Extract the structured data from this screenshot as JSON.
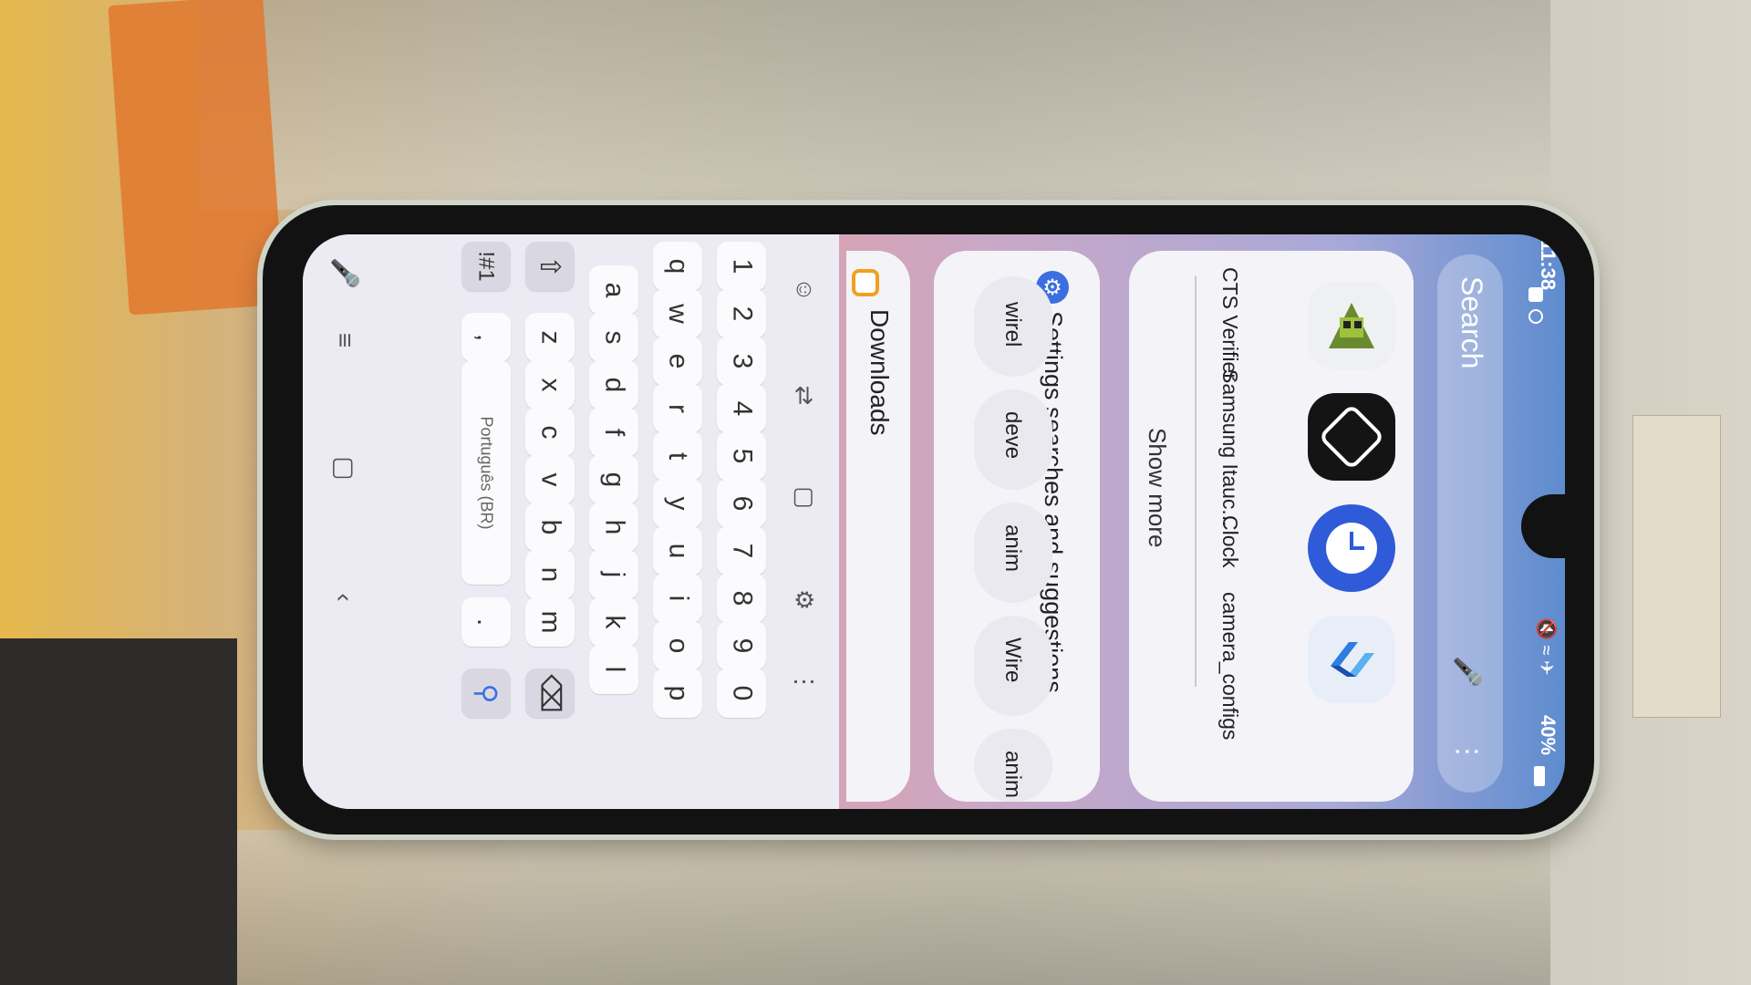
{
  "status_bar": {
    "time": "11:38",
    "battery": "40%",
    "icons": [
      "notification-icon",
      "sync-icon",
      "mute-icon",
      "wifi-icon",
      "airplane-icon",
      "battery-icon"
    ]
  },
  "search": {
    "placeholder": "Search",
    "mic_icon": "mic-icon",
    "more_icon": "more-vert-icon"
  },
  "apps": [
    {
      "label": "CTS Verifier",
      "icon": "cts-verifier-icon"
    },
    {
      "label": "Samsung Itauc...",
      "icon": "samsung-itau-icon"
    },
    {
      "label": "Clock",
      "icon": "clock-icon"
    },
    {
      "label": "camera_configs",
      "icon": "camera-configs-icon"
    }
  ],
  "show_more": "Show more",
  "settings_section": {
    "title": "Settings searches and suggestions",
    "chips": [
      "wirel",
      "deve",
      "anim",
      "Wire",
      "anim"
    ]
  },
  "downloads": {
    "title": "Downloads"
  },
  "keyboard": {
    "toolbar": [
      "emoji-icon",
      "translate-icon",
      "clipboard-icon",
      "settings-icon",
      "more-icon"
    ],
    "number_row": [
      "1",
      "2",
      "3",
      "4",
      "5",
      "6",
      "7",
      "8",
      "9",
      "0"
    ],
    "row1": [
      "q",
      "w",
      "e",
      "r",
      "t",
      "y",
      "u",
      "i",
      "o",
      "p"
    ],
    "row2": [
      "a",
      "s",
      "d",
      "f",
      "g",
      "h",
      "j",
      "k",
      "l"
    ],
    "row3": [
      "z",
      "x",
      "c",
      "v",
      "b",
      "n",
      "m"
    ],
    "symbols_key": "!#1",
    "comma_key": ",",
    "period_key": ".",
    "language": "Português (BR)",
    "shift_icon": "shift-icon",
    "backspace_icon": "backspace-icon",
    "search_key_icon": "search-icon",
    "voice_icon": "mic-icon"
  },
  "nav_bar": [
    "recents-icon",
    "home-icon",
    "back-icon"
  ],
  "colors": {
    "clock_blue": "#2f5bd8",
    "accent_blue": "#3c6ee0",
    "downloads_orange": "#f0a020"
  }
}
